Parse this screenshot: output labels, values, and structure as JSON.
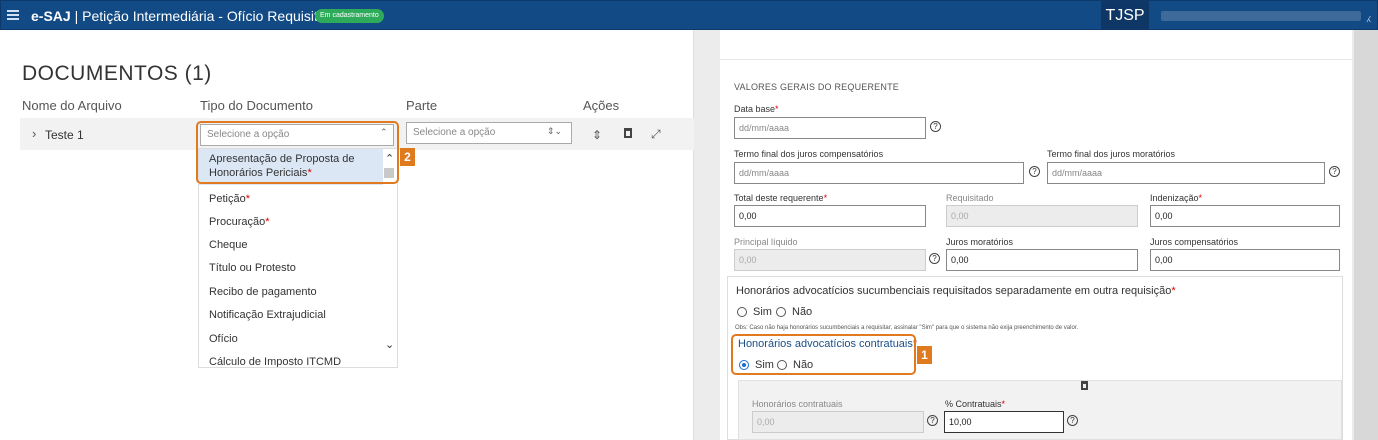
{
  "header": {
    "brand": "e-SAJ",
    "separator": " | ",
    "title": "Petição Intermediária - Ofício Requisitório",
    "badge": "Em cadastramento",
    "court": "TJSP",
    "colors": {
      "bar": "#124a85",
      "badge": "#2eab5a"
    }
  },
  "documents": {
    "title": "DOCUMENTOS (1)",
    "columns": [
      "Nome do Arquivo",
      "Tipo do Documento",
      "Parte",
      "Ações"
    ],
    "row": {
      "file": "Teste 1",
      "type_placeholder": "Selecione a opção",
      "part_placeholder": "Selecione a opção"
    },
    "dropdown": {
      "highlighted": {
        "line1": "Apresentação de Proposta de",
        "line2": "Honorários Periciais",
        "required_mark": "*"
      },
      "items": [
        {
          "label": "Petição",
          "required": "*"
        },
        {
          "label": "Procuração",
          "required": "*"
        },
        {
          "label": "Cheque",
          "required": ""
        },
        {
          "label": "Título ou Protesto",
          "required": ""
        },
        {
          "label": "Recibo de pagamento",
          "required": ""
        },
        {
          "label": "Notificação Extrajudicial",
          "required": ""
        },
        {
          "label": "Ofício",
          "required": ""
        },
        {
          "label": "Cálculo de Imposto ITCMD",
          "required": ""
        }
      ]
    },
    "callout_number": "2"
  },
  "form": {
    "section_title": "VALORES GERAIS DO REQUERENTE",
    "data_base": {
      "label": "Data base",
      "required": "*",
      "placeholder": "dd/mm/aaaa"
    },
    "termo_comp": {
      "label": "Termo final dos juros compensatórios",
      "placeholder": "dd/mm/aaaa"
    },
    "termo_mor": {
      "label": "Termo final dos juros moratórios",
      "placeholder": "dd/mm/aaaa"
    },
    "total": {
      "label": "Total deste requerente",
      "required": "*",
      "value": "0,00"
    },
    "requisitado": {
      "label": "Requisitado",
      "value": "0,00"
    },
    "indenizacao": {
      "label": "Indenização",
      "required": "*",
      "value": "0,00"
    },
    "principal": {
      "label": "Principal líquido",
      "value": "0,00"
    },
    "juros_mor": {
      "label": "Juros moratórios",
      "value": "0,00"
    },
    "juros_comp": {
      "label": "Juros compensatórios",
      "value": "0,00"
    },
    "sucumbenciais": {
      "label": "Honorários advocatícios sucumbenciais requisitados separadamente em outra requisição",
      "required": "*",
      "yes": "Sim",
      "no": "Não",
      "obs": "Obs: Caso não haja honorários sucumbenciais a requisitar, assinalar \"Sim\" para que o sistema não exija preenchimento de valor."
    },
    "contratuais": {
      "label": "Honorários advocatícios contratuais",
      "required": "*",
      "yes": "Sim",
      "no": "Não",
      "selected": "Sim"
    },
    "callout_number": "1",
    "hon_contratuais": {
      "label": "Honorários contratuais",
      "value": "0,00"
    },
    "pct_contratuais": {
      "label": "% Contratuais",
      "required": "*",
      "value": "10,00"
    },
    "help_glyph": "?"
  }
}
